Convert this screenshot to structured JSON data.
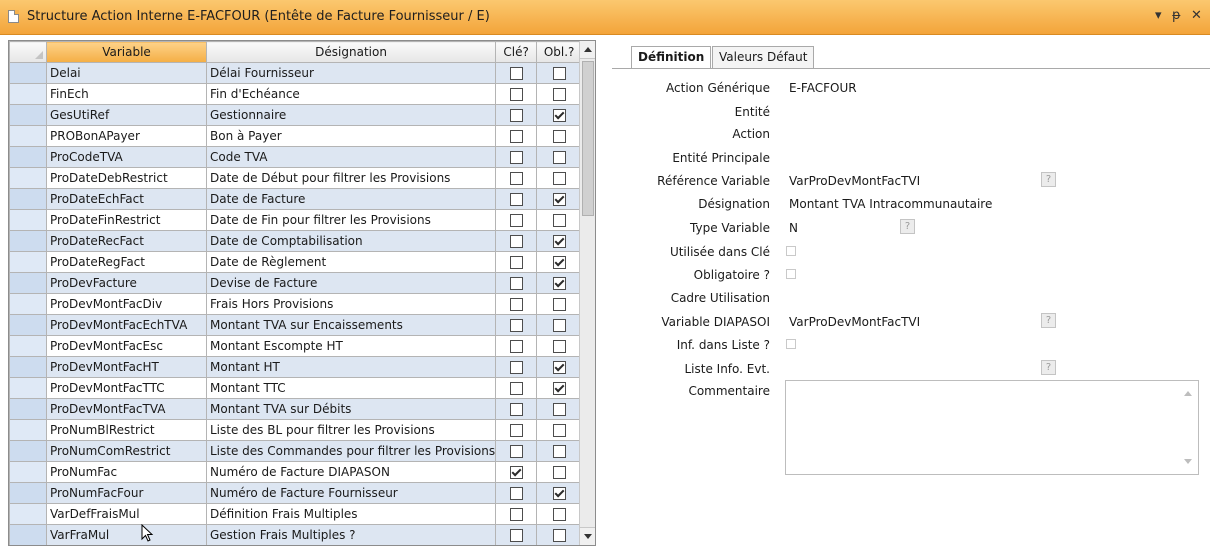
{
  "window": {
    "title": "Structure Action Interne E-FACFOUR (Entête de Facture Fournisseur / E)",
    "controls": [
      "▾",
      "ᵽ",
      "✕"
    ]
  },
  "grid": {
    "columns": [
      "Variable",
      "Désignation",
      "Clé?",
      "Obl.?"
    ],
    "rows": [
      {
        "variable": "Delai",
        "designation": "Délai Fournisseur",
        "cle": false,
        "obl": false
      },
      {
        "variable": "FinEch",
        "designation": "Fin d'Echéance",
        "cle": false,
        "obl": false
      },
      {
        "variable": "GesUtiRef",
        "designation": "Gestionnaire",
        "cle": false,
        "obl": true
      },
      {
        "variable": "PROBonAPayer",
        "designation": "Bon à Payer",
        "cle": false,
        "obl": false
      },
      {
        "variable": "ProCodeTVA",
        "designation": "Code TVA",
        "cle": false,
        "obl": false
      },
      {
        "variable": "ProDateDebRestrict",
        "designation": "Date de Début pour filtrer les Provisions",
        "cle": false,
        "obl": false
      },
      {
        "variable": "ProDateEchFact",
        "designation": "Date de Facture",
        "cle": false,
        "obl": true
      },
      {
        "variable": "ProDateFinRestrict",
        "designation": "Date de Fin pour filtrer les Provisions",
        "cle": false,
        "obl": false
      },
      {
        "variable": "ProDateRecFact",
        "designation": "Date de Comptabilisation",
        "cle": false,
        "obl": true
      },
      {
        "variable": "ProDateRegFact",
        "designation": "Date de Règlement",
        "cle": false,
        "obl": true
      },
      {
        "variable": "ProDevFacture",
        "designation": "Devise de Facture",
        "cle": false,
        "obl": true
      },
      {
        "variable": "ProDevMontFacDiv",
        "designation": "Frais Hors Provisions",
        "cle": false,
        "obl": false
      },
      {
        "variable": "ProDevMontFacEchTVA",
        "designation": "Montant TVA sur Encaissements",
        "cle": false,
        "obl": false
      },
      {
        "variable": "ProDevMontFacEsc",
        "designation": "Montant Escompte HT",
        "cle": false,
        "obl": false
      },
      {
        "variable": "ProDevMontFacHT",
        "designation": "Montant HT",
        "cle": false,
        "obl": true
      },
      {
        "variable": "ProDevMontFacTTC",
        "designation": "Montant TTC",
        "cle": false,
        "obl": true
      },
      {
        "variable": "ProDevMontFacTVA",
        "designation": "Montant TVA sur Débits",
        "cle": false,
        "obl": false
      },
      {
        "variable": "ProNumBlRestrict",
        "designation": "Liste des BL pour filtrer les Provisions",
        "cle": false,
        "obl": false
      },
      {
        "variable": "ProNumComRestrict",
        "designation": "Liste des Commandes pour filtrer les Provisions",
        "cle": false,
        "obl": false
      },
      {
        "variable": "ProNumFac",
        "designation": "Numéro de Facture DIAPASON",
        "cle": true,
        "obl": false
      },
      {
        "variable": "ProNumFacFour",
        "designation": "Numéro de Facture Fournisseur",
        "cle": false,
        "obl": true
      },
      {
        "variable": "VarDefFraisMul",
        "designation": "Définition Frais Multiples",
        "cle": false,
        "obl": false
      },
      {
        "variable": "VarFraMul",
        "designation": "Gestion Frais Multiples ?",
        "cle": false,
        "obl": false
      },
      {
        "variable": "VarProDevMontFacTVI",
        "designation": "Montant TVA Intracommunautaire",
        "cle": false,
        "obl": false
      }
    ],
    "selected_index": 23
  },
  "tabs": [
    "Définition",
    "Valeurs Défaut"
  ],
  "form": {
    "action_generique_label": "Action Générique",
    "action_generique_value": "E-FACFOUR",
    "entite_label": "Entité",
    "action_label": "Action",
    "entite_principale_label": "Entité Principale",
    "reference_variable_label": "Référence Variable",
    "reference_variable_value": "VarProDevMontFacTVI",
    "designation_label": "Désignation",
    "designation_value": "Montant TVA Intracommunautaire",
    "type_variable_label": "Type Variable",
    "type_variable_value": "N",
    "utilisee_cle_label": "Utilisée dans Clé",
    "obligatoire_label": "Obligatoire ?",
    "cadre_utilisation_label": "Cadre Utilisation",
    "variable_diapasoi_label": "Variable DIAPASOI",
    "variable_diapasoi_value": "VarProDevMontFacTVI",
    "inf_liste_label": "Inf. dans Liste ?",
    "liste_info_label": "Liste Info. Evt.",
    "commentaire_label": "Commentaire",
    "help_glyph": "?"
  }
}
